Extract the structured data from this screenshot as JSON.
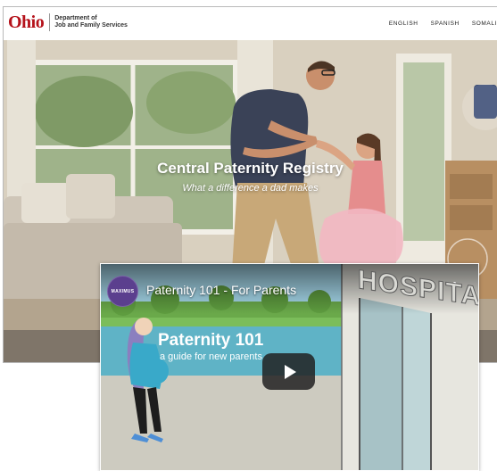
{
  "site": {
    "logo": {
      "wordmark": "Ohio",
      "department_line1": "Department of",
      "department_line2": "Job and Family Services"
    },
    "languages": [
      "ENGLISH",
      "SPANISH",
      "SOMALI"
    ],
    "hero": {
      "title": "Central Paternity Registry",
      "subtitle": "What a difference a dad makes"
    }
  },
  "video": {
    "channel_name": "MAXIMUS",
    "title": "Paternity 101 - For Parents",
    "heading": "Paternity 101",
    "subheading": "a guide for new parents",
    "sign_text": "HOSPITAL",
    "play_icon": "play-icon",
    "menu_icon": "more-vertical-icon"
  },
  "colors": {
    "ohio_red": "#b5121b",
    "play_button": "#212121",
    "avatar_purple": "#5b3f8e"
  }
}
